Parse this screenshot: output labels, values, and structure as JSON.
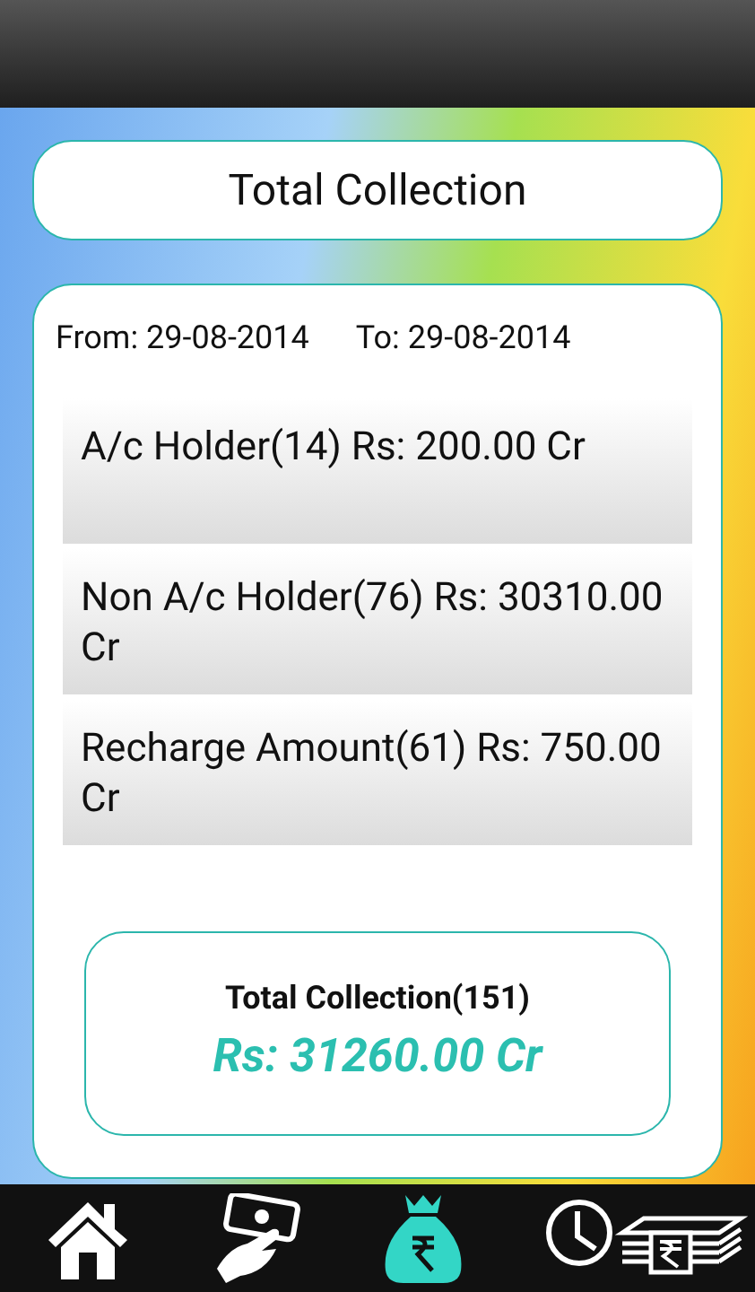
{
  "title": "Total Collection",
  "date_range": {
    "from": "From: 29-08-2014",
    "to": "To: 29-08-2014"
  },
  "rows": [
    {
      "text": "A/c Holder(14) Rs: 200.00 Cr"
    },
    {
      "text": "Non A/c Holder(76) Rs: 30310.00 Cr"
    },
    {
      "text": "Recharge Amount(61) Rs: 750.00 Cr"
    }
  ],
  "summary": {
    "label": "Total Collection(151)",
    "amount": "Rs: 31260.00 Cr"
  },
  "nav": [
    {
      "kind": "home",
      "selected": false
    },
    {
      "kind": "payment",
      "selected": false
    },
    {
      "kind": "moneybag",
      "selected": true
    },
    {
      "kind": "history",
      "selected": false
    }
  ]
}
